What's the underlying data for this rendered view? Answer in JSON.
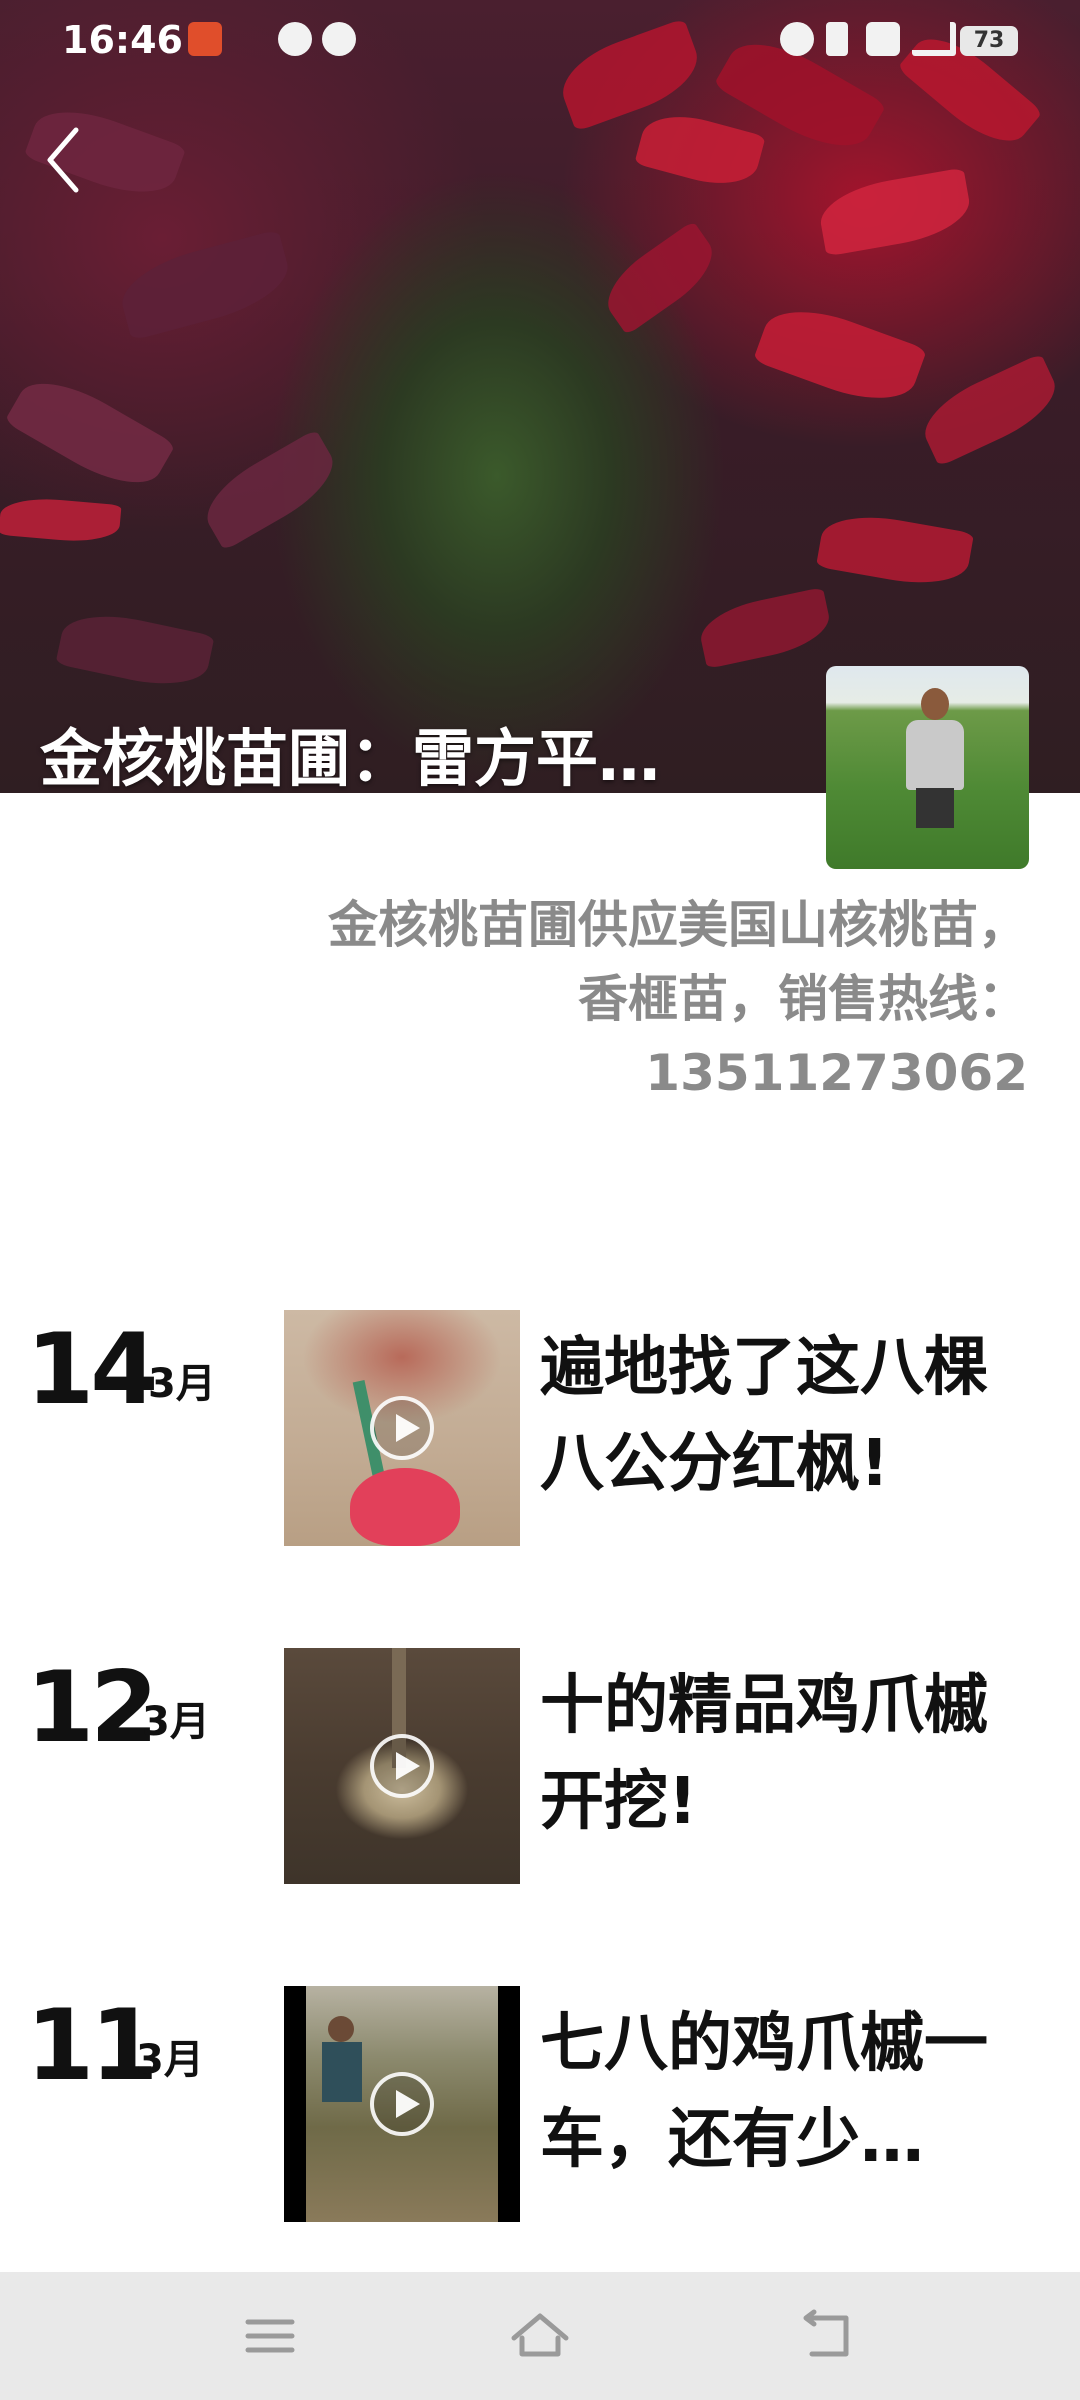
{
  "status_bar": {
    "time": "16:46",
    "battery": "73"
  },
  "header": {
    "title": "金核桃苗圃：雷方平…",
    "intro": "金核桃苗圃供应美国山核桃苗，香榧苗，销售热线：13511273062"
  },
  "posts": [
    {
      "day": "14",
      "month": "3月",
      "title": "遍地找了这八棵八公分红枫!"
    },
    {
      "day": "12",
      "month": "3月",
      "title": "十的精品鸡爪槭开挖!"
    },
    {
      "day": "11",
      "month": "3月",
      "title": "七八的鸡爪槭一车，还有少…"
    }
  ],
  "icons": {
    "back": "chevron-left-icon",
    "play": "play-icon",
    "nav_menu": "menu-icon",
    "nav_home": "home-icon",
    "nav_back": "back-icon"
  },
  "colors": {
    "intro_text": "#8a8a8a",
    "title_text": "#111111",
    "nav_bar": "#e9e9e9"
  }
}
